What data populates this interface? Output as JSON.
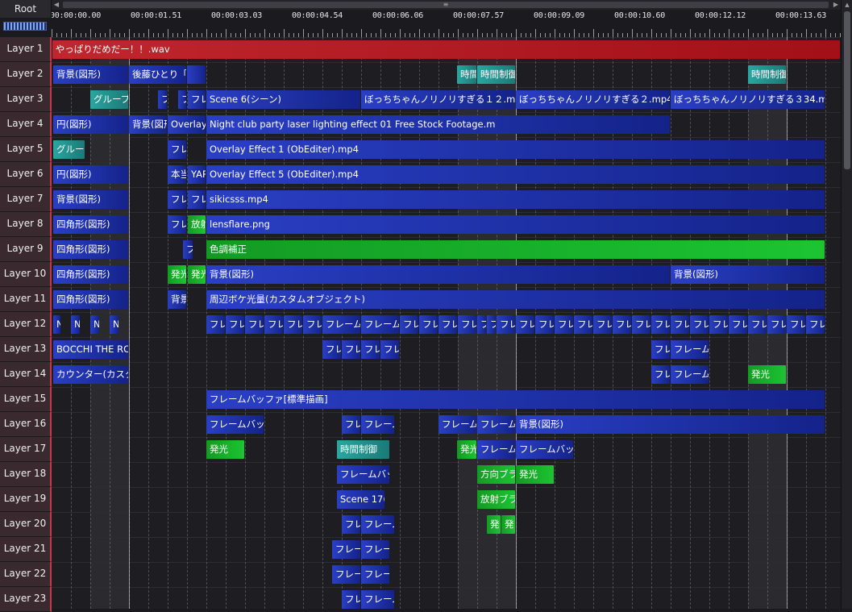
{
  "root_label": "Root",
  "scroll": {
    "left_arrow": "◀",
    "right_arrow": "▶",
    "grip": "≡",
    "up_arrow": "▲"
  },
  "ruler": {
    "labels": [
      "00:00:00.00",
      "00:00:01.51",
      "00:00:03.03",
      "00:00:04.54",
      "00:00:06.06",
      "00:00:07.57",
      "00:00:09.09",
      "00:00:10.60",
      "00:00:12.12",
      "00:00:13.63"
    ]
  },
  "layers": [
    "Layer 1",
    "Layer 2",
    "Layer 3",
    "Layer 4",
    "Layer 5",
    "Layer 6",
    "Layer 7",
    "Layer 8",
    "Layer 9",
    "Layer 10",
    "Layer 11",
    "Layer 12",
    "Layer 13",
    "Layer 14",
    "Layer 15",
    "Layer 16",
    "Layer 17",
    "Layer 18",
    "Layer 19",
    "Layer 20",
    "Layer 21",
    "Layer 22",
    "Layer 23"
  ],
  "clips": [
    {
      "layer": 1,
      "start": 0.8,
      "end": 979,
      "text": "やっぱりだめだー！！.wav",
      "color": "red"
    },
    {
      "layer": 2,
      "start": 2,
      "end": 96,
      "text": "背景(図形)",
      "color": "blue"
    },
    {
      "layer": 2,
      "start": 96,
      "end": 168,
      "text": "後藤ひとり「や",
      "color": "blue"
    },
    {
      "layer": 2,
      "start": 168,
      "end": 192,
      "text": "",
      "color": "blue"
    },
    {
      "layer": 2,
      "start": 503,
      "end": 528,
      "text": "時間",
      "color": "teal"
    },
    {
      "layer": 2,
      "start": 528,
      "end": 576,
      "text": "時間制御",
      "color": "teal"
    },
    {
      "layer": 2,
      "start": 864,
      "end": 912,
      "text": "時間制御",
      "color": "teal"
    },
    {
      "layer": 3,
      "start": 48,
      "end": 96,
      "text": "グループ制",
      "color": "teal"
    },
    {
      "layer": 3,
      "start": 132,
      "end": 144,
      "text": "フ",
      "color": "blue"
    },
    {
      "layer": 3,
      "start": 157,
      "end": 168,
      "text": "フ",
      "color": "blue"
    },
    {
      "layer": 3,
      "start": 169,
      "end": 192,
      "text": "フレ",
      "color": "blue"
    },
    {
      "layer": 3,
      "start": 192,
      "end": 384,
      "text": "Scene 6(シーン)",
      "color": "blue"
    },
    {
      "layer": 3,
      "start": 384,
      "end": 576,
      "text": "ぼっちちゃんノリノリすぎる１２.mp4",
      "color": "blue"
    },
    {
      "layer": 3,
      "start": 576,
      "end": 768,
      "text": "ぼっちちゃんノリノリすぎる２.mp4",
      "color": "blue"
    },
    {
      "layer": 3,
      "start": 768,
      "end": 960,
      "text": "ぼっちちゃんノリノリすぎる３34.mp4",
      "color": "blue"
    },
    {
      "layer": 4,
      "start": 2,
      "end": 96,
      "text": "円(図形)",
      "color": "blue"
    },
    {
      "layer": 4,
      "start": 96,
      "end": 144,
      "text": "背景(図形",
      "color": "blue"
    },
    {
      "layer": 4,
      "start": 144,
      "end": 192,
      "text": "Overlay",
      "color": "blue"
    },
    {
      "layer": 4,
      "start": 192,
      "end": 768,
      "text": "Night club party laser lighting effect 01  Free Stock Footage.m",
      "color": "blue"
    },
    {
      "layer": 5,
      "start": 2,
      "end": 42,
      "text": "グループ",
      "color": "teal"
    },
    {
      "layer": 5,
      "start": 144,
      "end": 168,
      "text": "フレ",
      "color": "blue"
    },
    {
      "layer": 5,
      "start": 192,
      "end": 960,
      "text": "Overlay Effect 1 (ObEditer).mp4",
      "color": "blue"
    },
    {
      "layer": 6,
      "start": 2,
      "end": 96,
      "text": "円(図形)",
      "color": "blue"
    },
    {
      "layer": 6,
      "start": 144,
      "end": 168,
      "text": "本当",
      "color": "blue"
    },
    {
      "layer": 6,
      "start": 169,
      "end": 192,
      "text": "YAR",
      "color": "blue"
    },
    {
      "layer": 6,
      "start": 192,
      "end": 960,
      "text": "Overlay Effect 5 (ObEditer).mp4",
      "color": "blue"
    },
    {
      "layer": 7,
      "start": 2,
      "end": 96,
      "text": "背景(図形)",
      "color": "blue"
    },
    {
      "layer": 7,
      "start": 144,
      "end": 168,
      "text": "フレ",
      "color": "blue"
    },
    {
      "layer": 7,
      "start": 169,
      "end": 192,
      "text": "フレ",
      "color": "blue"
    },
    {
      "layer": 7,
      "start": 192,
      "end": 960,
      "text": "sikicsss.mp4",
      "color": "blue"
    },
    {
      "layer": 8,
      "start": 2,
      "end": 96,
      "text": "四角形(図形)",
      "color": "blue"
    },
    {
      "layer": 8,
      "start": 144,
      "end": 168,
      "text": "フレ",
      "color": "blue"
    },
    {
      "layer": 8,
      "start": 169,
      "end": 192,
      "text": "放射",
      "color": "green"
    },
    {
      "layer": 8,
      "start": 192,
      "end": 960,
      "text": "lensflare.png",
      "color": "blue"
    },
    {
      "layer": 9,
      "start": 2,
      "end": 96,
      "text": "四角形(図形)",
      "color": "blue"
    },
    {
      "layer": 9,
      "start": 163,
      "end": 176,
      "text": "フ",
      "color": "blue"
    },
    {
      "layer": 9,
      "start": 192,
      "end": 960,
      "text": "色調補正",
      "color": "green"
    },
    {
      "layer": 10,
      "start": 2,
      "end": 96,
      "text": "四角形(図形)",
      "color": "blue"
    },
    {
      "layer": 10,
      "start": 144,
      "end": 168,
      "text": "発光",
      "color": "green"
    },
    {
      "layer": 10,
      "start": 169,
      "end": 192,
      "text": "発光",
      "color": "green"
    },
    {
      "layer": 10,
      "start": 192,
      "end": 768,
      "text": "背景(図形)",
      "color": "blue"
    },
    {
      "layer": 10,
      "start": 768,
      "end": 960,
      "text": "背景(図形)",
      "color": "blue"
    },
    {
      "layer": 11,
      "start": 2,
      "end": 96,
      "text": "四角形(図形)",
      "color": "blue"
    },
    {
      "layer": 11,
      "start": 144,
      "end": 168,
      "text": "背景",
      "color": "blue"
    },
    {
      "layer": 11,
      "start": 192,
      "end": 960,
      "text": "周辺ボケ光量(カスタムオブジェクト)",
      "color": "blue"
    },
    {
      "layer": 12,
      "start": 2,
      "end": 12,
      "text": "N",
      "color": "blue"
    },
    {
      "layer": 12,
      "start": 24,
      "end": 36,
      "text": "N",
      "color": "blue"
    },
    {
      "layer": 12,
      "start": 48,
      "end": 60,
      "text": "N",
      "color": "blue"
    },
    {
      "layer": 12,
      "start": 72,
      "end": 84,
      "text": "N",
      "color": "blue"
    },
    {
      "layer": 12,
      "start": 192,
      "end": 216,
      "text": "フレ",
      "color": "blue"
    },
    {
      "layer": 12,
      "start": 216,
      "end": 240,
      "text": "フレ",
      "color": "blue"
    },
    {
      "layer": 12,
      "start": 240,
      "end": 264,
      "text": "フレ",
      "color": "blue"
    },
    {
      "layer": 12,
      "start": 264,
      "end": 288,
      "text": "フレ",
      "color": "blue"
    },
    {
      "layer": 12,
      "start": 288,
      "end": 312,
      "text": "フレ",
      "color": "blue"
    },
    {
      "layer": 12,
      "start": 312,
      "end": 336,
      "text": "フレ",
      "color": "blue"
    },
    {
      "layer": 12,
      "start": 336,
      "end": 384,
      "text": "フレームバ",
      "color": "blue"
    },
    {
      "layer": 12,
      "start": 384,
      "end": 432,
      "text": "フレームバ",
      "color": "blue"
    },
    {
      "layer": 12,
      "start": 432,
      "end": 456,
      "text": "フレ",
      "color": "blue"
    },
    {
      "layer": 12,
      "start": 456,
      "end": 480,
      "text": "フレ",
      "color": "blue"
    },
    {
      "layer": 12,
      "start": 480,
      "end": 504,
      "text": "フレ",
      "color": "blue"
    },
    {
      "layer": 12,
      "start": 504,
      "end": 528,
      "text": "フレ",
      "color": "blue"
    },
    {
      "layer": 12,
      "start": 528,
      "end": 540,
      "text": "フ",
      "color": "blue"
    },
    {
      "layer": 12,
      "start": 540,
      "end": 552,
      "text": "フ",
      "color": "blue"
    },
    {
      "layer": 12,
      "start": 552,
      "end": 576,
      "text": "フレ",
      "color": "blue"
    },
    {
      "layer": 12,
      "start": 576,
      "end": 600,
      "text": "フレ",
      "color": "blue"
    },
    {
      "layer": 12,
      "start": 600,
      "end": 624,
      "text": "フレ",
      "color": "blue"
    },
    {
      "layer": 12,
      "start": 624,
      "end": 648,
      "text": "フレ",
      "color": "blue"
    },
    {
      "layer": 12,
      "start": 648,
      "end": 672,
      "text": "フレ",
      "color": "blue"
    },
    {
      "layer": 12,
      "start": 672,
      "end": 696,
      "text": "フレ",
      "color": "blue"
    },
    {
      "layer": 12,
      "start": 696,
      "end": 720,
      "text": "フレ",
      "color": "blue"
    },
    {
      "layer": 12,
      "start": 720,
      "end": 744,
      "text": "フレ",
      "color": "blue"
    },
    {
      "layer": 12,
      "start": 744,
      "end": 768,
      "text": "フレ",
      "color": "blue"
    },
    {
      "layer": 12,
      "start": 768,
      "end": 792,
      "text": "フレ",
      "color": "blue"
    },
    {
      "layer": 12,
      "start": 792,
      "end": 816,
      "text": "フレ",
      "color": "blue"
    },
    {
      "layer": 12,
      "start": 816,
      "end": 840,
      "text": "フレ",
      "color": "blue"
    },
    {
      "layer": 12,
      "start": 840,
      "end": 864,
      "text": "フレ",
      "color": "blue"
    },
    {
      "layer": 12,
      "start": 864,
      "end": 888,
      "text": "フレ",
      "color": "blue"
    },
    {
      "layer": 12,
      "start": 888,
      "end": 912,
      "text": "フレ",
      "color": "blue"
    },
    {
      "layer": 12,
      "start": 912,
      "end": 936,
      "text": "フレ",
      "color": "blue"
    },
    {
      "layer": 12,
      "start": 936,
      "end": 960,
      "text": "フレ",
      "color": "blue"
    },
    {
      "layer": 13,
      "start": 2,
      "end": 96,
      "text": "BOCCHI THE ROCK",
      "color": "blue"
    },
    {
      "layer": 13,
      "start": 336,
      "end": 360,
      "text": "フレ",
      "color": "blue"
    },
    {
      "layer": 13,
      "start": 360,
      "end": 384,
      "text": "フレ",
      "color": "blue"
    },
    {
      "layer": 13,
      "start": 384,
      "end": 408,
      "text": "フレ",
      "color": "blue"
    },
    {
      "layer": 13,
      "start": 408,
      "end": 432,
      "text": "フレ",
      "color": "blue"
    },
    {
      "layer": 13,
      "start": 744,
      "end": 768,
      "text": "フレ",
      "color": "blue"
    },
    {
      "layer": 13,
      "start": 768,
      "end": 816,
      "text": "フレームバ",
      "color": "blue"
    },
    {
      "layer": 14,
      "start": 2,
      "end": 96,
      "text": "カウンター(カスタムオ",
      "color": "blue"
    },
    {
      "layer": 14,
      "start": 744,
      "end": 768,
      "text": "フレ",
      "color": "blue"
    },
    {
      "layer": 14,
      "start": 768,
      "end": 816,
      "text": "フレームバ",
      "color": "blue"
    },
    {
      "layer": 14,
      "start": 864,
      "end": 912,
      "text": "発光",
      "color": "green"
    },
    {
      "layer": 15,
      "start": 192,
      "end": 960,
      "text": "フレームバッファ[標準描画]",
      "color": "blue"
    },
    {
      "layer": 16,
      "start": 192,
      "end": 264,
      "text": "フレームバッファ",
      "color": "blue"
    },
    {
      "layer": 16,
      "start": 360,
      "end": 384,
      "text": "フレ",
      "color": "blue"
    },
    {
      "layer": 16,
      "start": 384,
      "end": 426,
      "text": "フレームバ",
      "color": "blue"
    },
    {
      "layer": 16,
      "start": 480,
      "end": 528,
      "text": "フレームバ",
      "color": "blue"
    },
    {
      "layer": 16,
      "start": 528,
      "end": 576,
      "text": "フレームバ",
      "color": "blue"
    },
    {
      "layer": 16,
      "start": 576,
      "end": 960,
      "text": "背景(図形)",
      "color": "blue"
    },
    {
      "layer": 17,
      "start": 192,
      "end": 240,
      "text": "発光",
      "color": "green"
    },
    {
      "layer": 17,
      "start": 354,
      "end": 420,
      "text": "時間制御",
      "color": "teal"
    },
    {
      "layer": 17,
      "start": 503,
      "end": 528,
      "text": "発光",
      "color": "green"
    },
    {
      "layer": 17,
      "start": 528,
      "end": 576,
      "text": "フレームバ",
      "color": "blue"
    },
    {
      "layer": 17,
      "start": 576,
      "end": 648,
      "text": "フレームバッファ",
      "color": "blue"
    },
    {
      "layer": 18,
      "start": 354,
      "end": 420,
      "text": "フレームバッフ",
      "color": "blue"
    },
    {
      "layer": 18,
      "start": 528,
      "end": 576,
      "text": "方向ブラ",
      "color": "green"
    },
    {
      "layer": 18,
      "start": 576,
      "end": 624,
      "text": "発光",
      "color": "green"
    },
    {
      "layer": 19,
      "start": 354,
      "end": 414,
      "text": "Scene 17(シーン)",
      "color": "blue"
    },
    {
      "layer": 19,
      "start": 528,
      "end": 576,
      "text": "放射ブラ",
      "color": "green"
    },
    {
      "layer": 20,
      "start": 360,
      "end": 384,
      "text": "フレ",
      "color": "blue"
    },
    {
      "layer": 20,
      "start": 384,
      "end": 426,
      "text": "フレームバ",
      "color": "blue"
    },
    {
      "layer": 20,
      "start": 540,
      "end": 558,
      "text": "発",
      "color": "green"
    },
    {
      "layer": 20,
      "start": 558,
      "end": 576,
      "text": "発",
      "color": "green"
    },
    {
      "layer": 21,
      "start": 348,
      "end": 384,
      "text": "フレーム",
      "color": "blue"
    },
    {
      "layer": 21,
      "start": 384,
      "end": 420,
      "text": "フレームバ",
      "color": "blue"
    },
    {
      "layer": 22,
      "start": 348,
      "end": 384,
      "text": "フレーム",
      "color": "blue"
    },
    {
      "layer": 22,
      "start": 384,
      "end": 420,
      "text": "フレームバ",
      "color": "blue"
    },
    {
      "layer": 23,
      "start": 360,
      "end": 384,
      "text": "フレ",
      "color": "blue"
    },
    {
      "layer": 23,
      "start": 384,
      "end": 426,
      "text": "フレームバ",
      "color": "blue"
    }
  ]
}
